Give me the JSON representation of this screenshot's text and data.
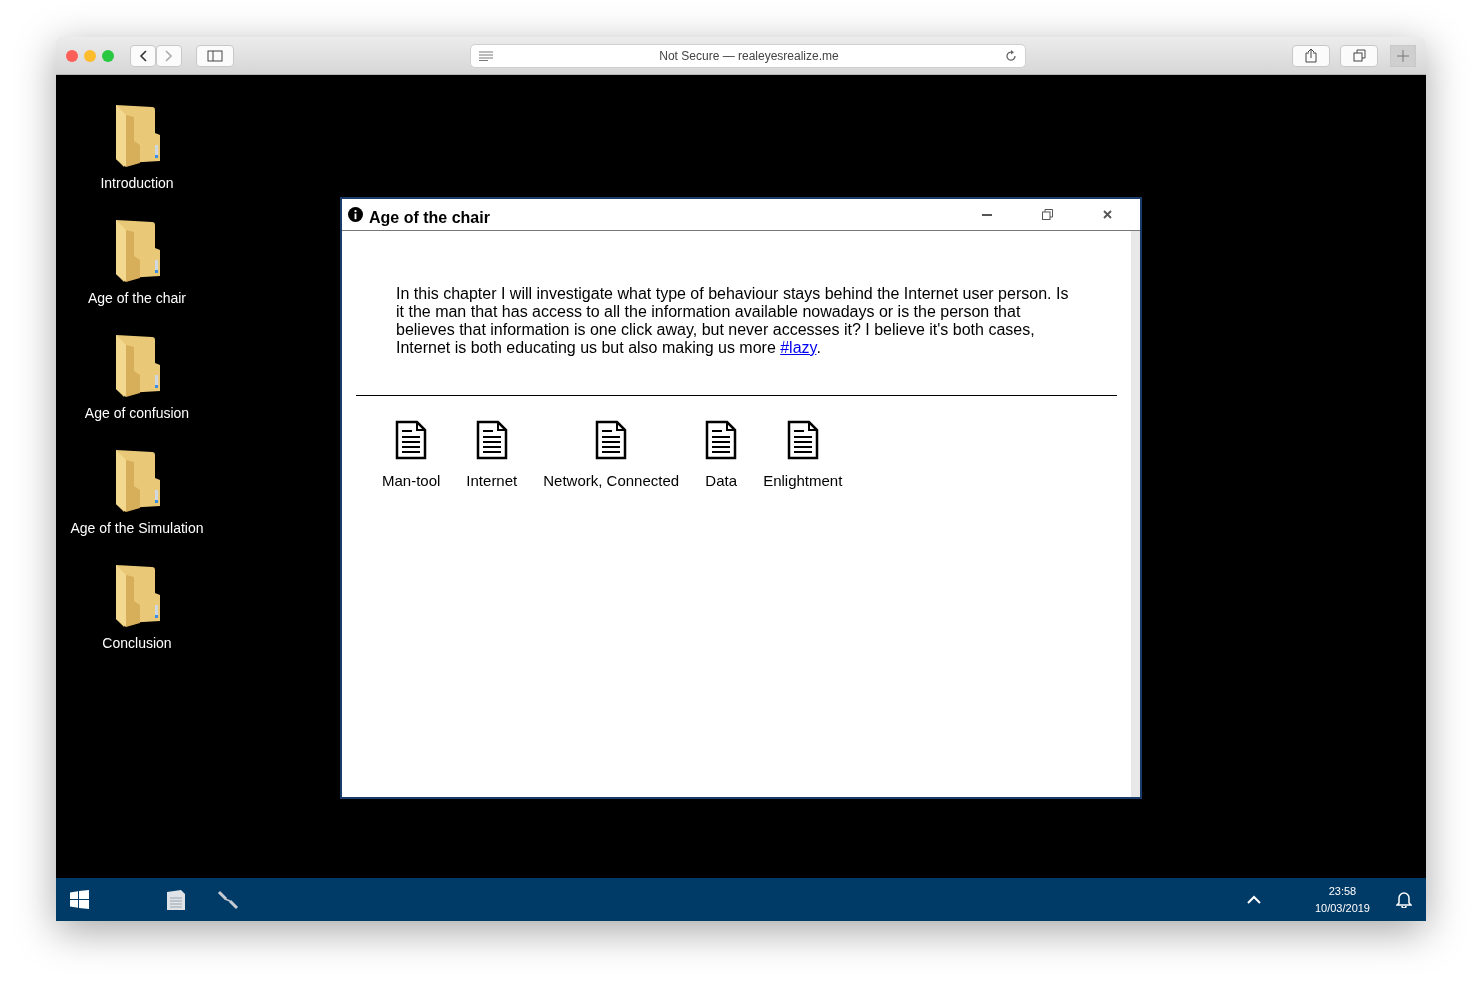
{
  "browser": {
    "address": "Not Secure — realeyesrealize.me"
  },
  "desktop_icons": [
    {
      "label": "Introduction"
    },
    {
      "label": "Age of the chair"
    },
    {
      "label": "Age of confusion"
    },
    {
      "label": "Age of the Simulation"
    },
    {
      "label": "Conclusion"
    }
  ],
  "dialog": {
    "title": "Age of the chair",
    "paragraph": "In this chapter I will investigate what type of behaviour stays behind the Internet user person. Is it the man that has access to all the information available nowadays or is the person that believes that information is one click away, but never accesses it? I believe it's both cases, Internet is both educating us but also making us more ",
    "link": "#lazy",
    "paragraph_end": ".",
    "files": [
      {
        "label": "Man-tool"
      },
      {
        "label": "Internet"
      },
      {
        "label": "Network, Connected"
      },
      {
        "label": "Data"
      },
      {
        "label": "Enlightment"
      }
    ]
  },
  "taskbar": {
    "time": "23:58",
    "date": "10/03/2019"
  }
}
